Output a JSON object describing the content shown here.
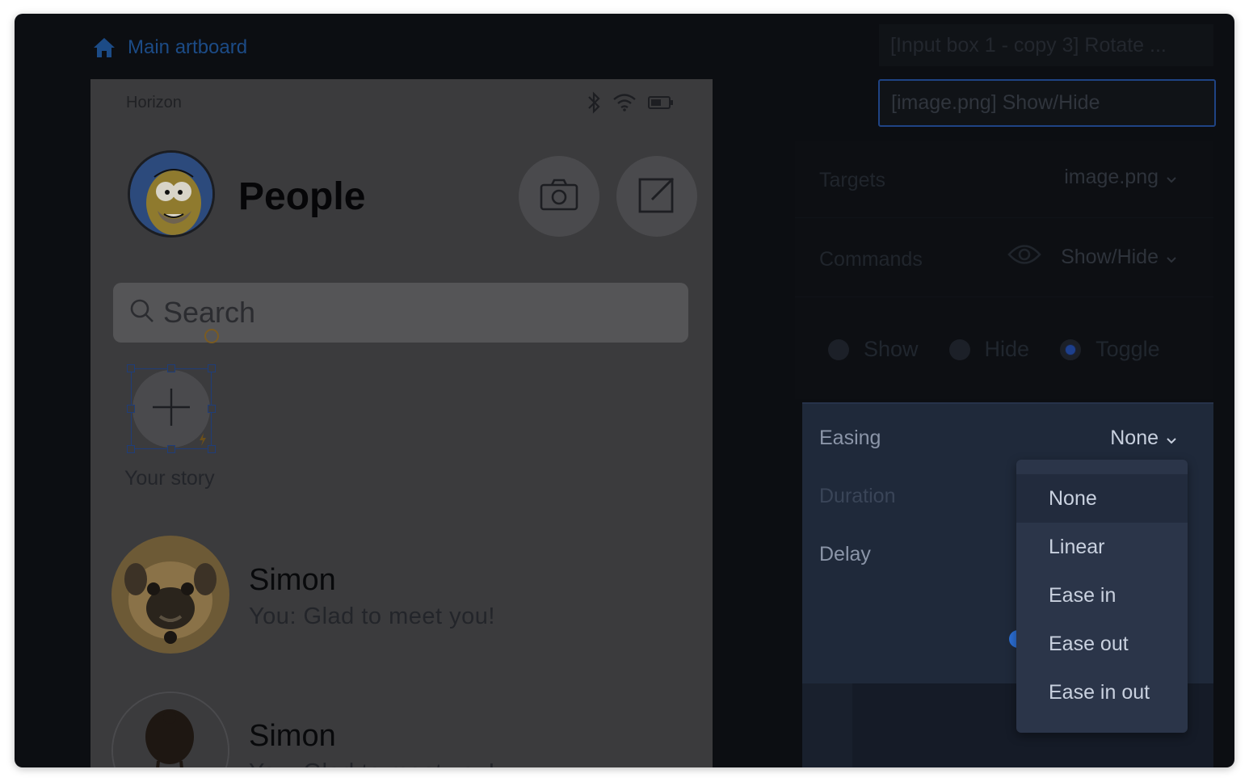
{
  "breadcrumb": {
    "label": "Main artboard"
  },
  "phone": {
    "carrier": "Horizon",
    "title": "People",
    "search_placeholder": "Search",
    "story_label": "Your story",
    "contacts": [
      {
        "name": "Simon",
        "message": "You:  Glad to meet you!"
      },
      {
        "name": "Simon",
        "message": "You:  Glad to meet you!"
      }
    ]
  },
  "interactions": {
    "items": [
      "[Input box 1 - copy 3] Rotate ...",
      "[image.png] Show/Hide"
    ]
  },
  "properties": {
    "targets_label": "Targets",
    "targets_value": "image.png",
    "commands_label": "Commands",
    "commands_value": "Show/Hide",
    "radio_options": [
      {
        "label": "Show",
        "selected": false
      },
      {
        "label": "Hide",
        "selected": false
      },
      {
        "label": "Toggle",
        "selected": true
      }
    ]
  },
  "easing": {
    "label": "Easing",
    "value": "None",
    "duration_label": "Duration",
    "delay_label": "Delay",
    "options": [
      "None",
      "Linear",
      "Ease in",
      "Ease out",
      "Ease in out"
    ],
    "selected_option": "None"
  },
  "colors": {
    "accent": "#1f4384",
    "window_bg": "#0c0e12",
    "artboard_bg": "#3b3b3d",
    "dropdown_bg": "#2b3549"
  }
}
